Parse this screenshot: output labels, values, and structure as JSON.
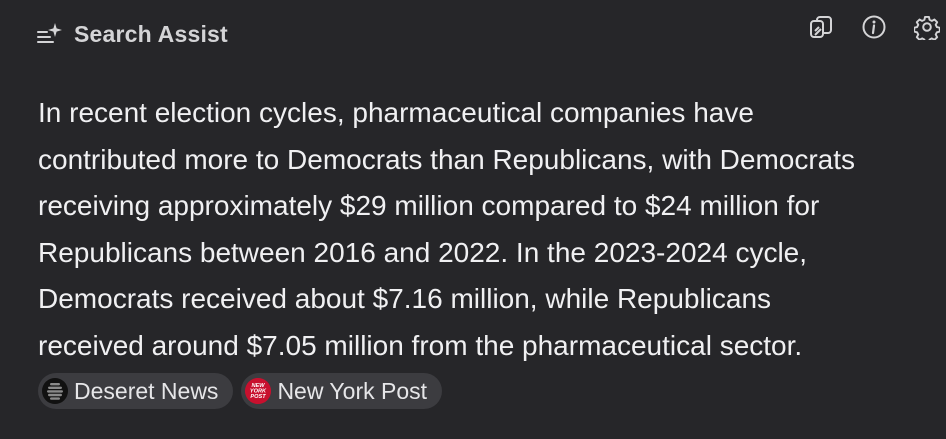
{
  "header": {
    "title": "Search Assist",
    "icons": [
      "sparkle-list-icon",
      "copy-icon",
      "info-icon",
      "gear-icon"
    ]
  },
  "answer": {
    "lines": [
      "In recent election cycles, pharmaceutical companies have",
      "contributed more to Democrats than Republicans, with Democrats",
      "receiving approximately $29 million compared to $24 million for",
      "Republicans between 2016 and 2022. In the 2023-2024 cycle,",
      "Democrats received about $7.16 million, while Republicans",
      "received around $7.05 million from the pharmaceutical sector."
    ]
  },
  "sources": [
    {
      "label": "Deseret News",
      "icon": "deseret-news-favicon"
    },
    {
      "label": "New York Post",
      "icon": "new-york-post-favicon",
      "icon_text": [
        "NEW",
        "YORK",
        "POST"
      ]
    }
  ],
  "colors": {
    "background": "#262629",
    "text": "#f0f0f2",
    "chip": "#3c3c40",
    "nypost_red": "#c8102e"
  }
}
